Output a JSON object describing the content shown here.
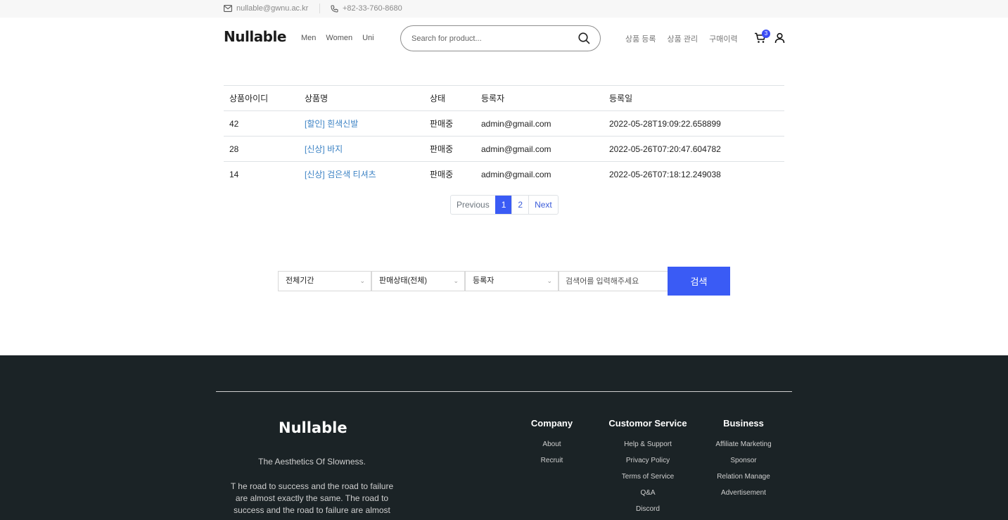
{
  "topbar": {
    "email": "nullable@gwnu.ac.kr",
    "phone": "+82-33-760-8680"
  },
  "header": {
    "logo": "Nullable",
    "nav": [
      "Men",
      "Women",
      "Uni"
    ],
    "search_placeholder": "Search for product...",
    "admin_links": [
      "상품 등록",
      "상품 관리",
      "구매이력"
    ],
    "cart_count": "3"
  },
  "table": {
    "headers": [
      "상품아이디",
      "상품명",
      "상태",
      "등록자",
      "등록일"
    ],
    "rows": [
      {
        "id": "42",
        "name": "[할인] 흰색신발",
        "status": "판매중",
        "registrant": "admin@gmail.com",
        "date": "2022-05-28T19:09:22.658899"
      },
      {
        "id": "28",
        "name": "[신상] 바지",
        "status": "판매중",
        "registrant": "admin@gmail.com",
        "date": "2022-05-26T07:20:47.604782"
      },
      {
        "id": "14",
        "name": "[신상] 검은색 티셔츠",
        "status": "판매중",
        "registrant": "admin@gmail.com",
        "date": "2022-05-26T07:18:12.249038"
      }
    ]
  },
  "pagination": {
    "previous": "Previous",
    "pages": [
      "1",
      "2"
    ],
    "next": "Next"
  },
  "filters": {
    "period": "전체기간",
    "sale_status": "판매상태(전체)",
    "field": "등록자",
    "keyword_placeholder": "검색어를 입력해주세요",
    "search_button": "검색"
  },
  "footer": {
    "logo": "Nullable",
    "tagline": "The Aesthetics Of Slowness.",
    "description": "T he road to success and the road to failure are almost exactly the same. The road to success and the road to failure are almost",
    "columns": [
      {
        "title": "Company",
        "items": [
          "About",
          "Recruit"
        ]
      },
      {
        "title": "Customor Service",
        "items": [
          "Help & Support",
          "Privacy Policy",
          "Terms of Service",
          "Q&A",
          "Discord"
        ]
      },
      {
        "title": "Business",
        "items": [
          "Affiliate Marketing",
          "Sponsor",
          "Relation Manage",
          "Advertisement"
        ]
      }
    ]
  },
  "colors": {
    "accent": "#3a5bf5",
    "footer_bg": "#1b2326",
    "link": "#3b82c4"
  }
}
